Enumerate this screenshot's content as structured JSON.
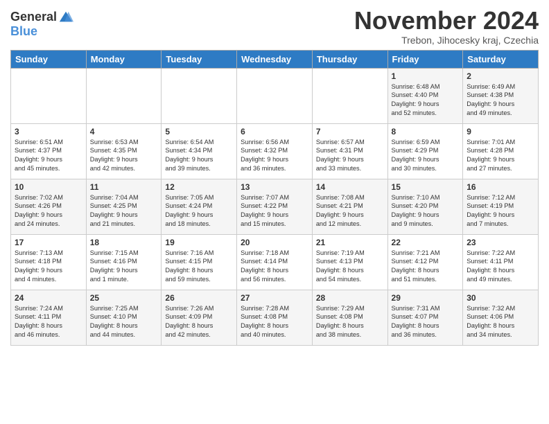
{
  "header": {
    "logo_line1": "General",
    "logo_line2": "Blue",
    "month_title": "November 2024",
    "location": "Trebon, Jihocesky kraj, Czechia"
  },
  "weekdays": [
    "Sunday",
    "Monday",
    "Tuesday",
    "Wednesday",
    "Thursday",
    "Friday",
    "Saturday"
  ],
  "weeks": [
    [
      {
        "day": "",
        "info": ""
      },
      {
        "day": "",
        "info": ""
      },
      {
        "day": "",
        "info": ""
      },
      {
        "day": "",
        "info": ""
      },
      {
        "day": "",
        "info": ""
      },
      {
        "day": "1",
        "info": "Sunrise: 6:48 AM\nSunset: 4:40 PM\nDaylight: 9 hours\nand 52 minutes."
      },
      {
        "day": "2",
        "info": "Sunrise: 6:49 AM\nSunset: 4:38 PM\nDaylight: 9 hours\nand 49 minutes."
      }
    ],
    [
      {
        "day": "3",
        "info": "Sunrise: 6:51 AM\nSunset: 4:37 PM\nDaylight: 9 hours\nand 45 minutes."
      },
      {
        "day": "4",
        "info": "Sunrise: 6:53 AM\nSunset: 4:35 PM\nDaylight: 9 hours\nand 42 minutes."
      },
      {
        "day": "5",
        "info": "Sunrise: 6:54 AM\nSunset: 4:34 PM\nDaylight: 9 hours\nand 39 minutes."
      },
      {
        "day": "6",
        "info": "Sunrise: 6:56 AM\nSunset: 4:32 PM\nDaylight: 9 hours\nand 36 minutes."
      },
      {
        "day": "7",
        "info": "Sunrise: 6:57 AM\nSunset: 4:31 PM\nDaylight: 9 hours\nand 33 minutes."
      },
      {
        "day": "8",
        "info": "Sunrise: 6:59 AM\nSunset: 4:29 PM\nDaylight: 9 hours\nand 30 minutes."
      },
      {
        "day": "9",
        "info": "Sunrise: 7:01 AM\nSunset: 4:28 PM\nDaylight: 9 hours\nand 27 minutes."
      }
    ],
    [
      {
        "day": "10",
        "info": "Sunrise: 7:02 AM\nSunset: 4:26 PM\nDaylight: 9 hours\nand 24 minutes."
      },
      {
        "day": "11",
        "info": "Sunrise: 7:04 AM\nSunset: 4:25 PM\nDaylight: 9 hours\nand 21 minutes."
      },
      {
        "day": "12",
        "info": "Sunrise: 7:05 AM\nSunset: 4:24 PM\nDaylight: 9 hours\nand 18 minutes."
      },
      {
        "day": "13",
        "info": "Sunrise: 7:07 AM\nSunset: 4:22 PM\nDaylight: 9 hours\nand 15 minutes."
      },
      {
        "day": "14",
        "info": "Sunrise: 7:08 AM\nSunset: 4:21 PM\nDaylight: 9 hours\nand 12 minutes."
      },
      {
        "day": "15",
        "info": "Sunrise: 7:10 AM\nSunset: 4:20 PM\nDaylight: 9 hours\nand 9 minutes."
      },
      {
        "day": "16",
        "info": "Sunrise: 7:12 AM\nSunset: 4:19 PM\nDaylight: 9 hours\nand 7 minutes."
      }
    ],
    [
      {
        "day": "17",
        "info": "Sunrise: 7:13 AM\nSunset: 4:18 PM\nDaylight: 9 hours\nand 4 minutes."
      },
      {
        "day": "18",
        "info": "Sunrise: 7:15 AM\nSunset: 4:16 PM\nDaylight: 9 hours\nand 1 minute."
      },
      {
        "day": "19",
        "info": "Sunrise: 7:16 AM\nSunset: 4:15 PM\nDaylight: 8 hours\nand 59 minutes."
      },
      {
        "day": "20",
        "info": "Sunrise: 7:18 AM\nSunset: 4:14 PM\nDaylight: 8 hours\nand 56 minutes."
      },
      {
        "day": "21",
        "info": "Sunrise: 7:19 AM\nSunset: 4:13 PM\nDaylight: 8 hours\nand 54 minutes."
      },
      {
        "day": "22",
        "info": "Sunrise: 7:21 AM\nSunset: 4:12 PM\nDaylight: 8 hours\nand 51 minutes."
      },
      {
        "day": "23",
        "info": "Sunrise: 7:22 AM\nSunset: 4:11 PM\nDaylight: 8 hours\nand 49 minutes."
      }
    ],
    [
      {
        "day": "24",
        "info": "Sunrise: 7:24 AM\nSunset: 4:11 PM\nDaylight: 8 hours\nand 46 minutes."
      },
      {
        "day": "25",
        "info": "Sunrise: 7:25 AM\nSunset: 4:10 PM\nDaylight: 8 hours\nand 44 minutes."
      },
      {
        "day": "26",
        "info": "Sunrise: 7:26 AM\nSunset: 4:09 PM\nDaylight: 8 hours\nand 42 minutes."
      },
      {
        "day": "27",
        "info": "Sunrise: 7:28 AM\nSunset: 4:08 PM\nDaylight: 8 hours\nand 40 minutes."
      },
      {
        "day": "28",
        "info": "Sunrise: 7:29 AM\nSunset: 4:08 PM\nDaylight: 8 hours\nand 38 minutes."
      },
      {
        "day": "29",
        "info": "Sunrise: 7:31 AM\nSunset: 4:07 PM\nDaylight: 8 hours\nand 36 minutes."
      },
      {
        "day": "30",
        "info": "Sunrise: 7:32 AM\nSunset: 4:06 PM\nDaylight: 8 hours\nand 34 minutes."
      }
    ]
  ]
}
